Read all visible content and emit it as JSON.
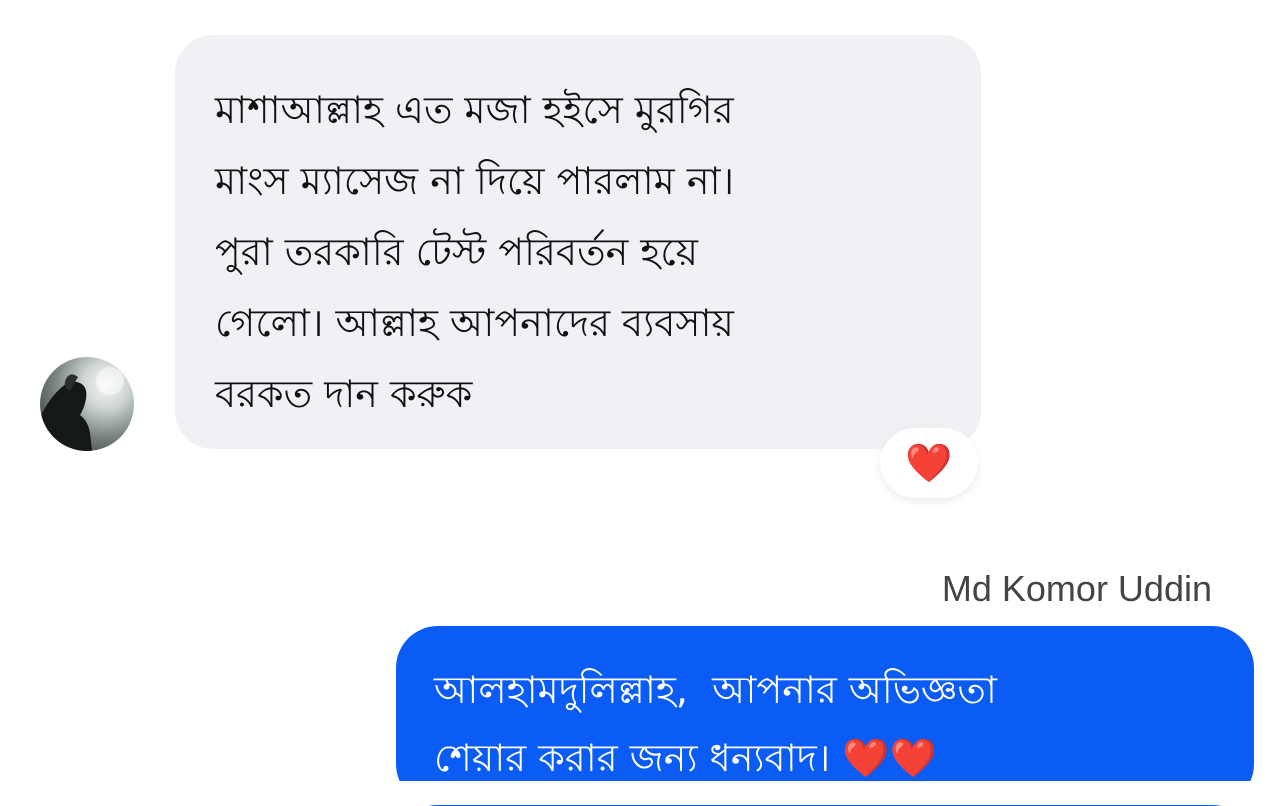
{
  "conversation": {
    "incoming": {
      "text": "মাশাআল্লাহ এত মজা হইসে মুরগির\nমাংস ম্যাসেজ না দিয়ে পারলাম না।\nপুরা তরকারি টেস্ট পরিবর্তন হয়ে\nগেলো। আল্লাহ আপনাদের ব্যবসায়\nবরকত দান করুক",
      "reaction": "❤️"
    },
    "outgoing": {
      "sender": "Md Komor Uddin",
      "text": "আলহামদুলিল্লাহ,  আপনার অভিজ্ঞতা\nশেয়ার করার জন্য ধন্যবাদ। ",
      "hearts": "❤️❤️"
    }
  },
  "colors": {
    "incoming_bubble": "#f0f1f4",
    "outgoing_bubble": "#0a5cf5",
    "heart": "#e5202b"
  }
}
